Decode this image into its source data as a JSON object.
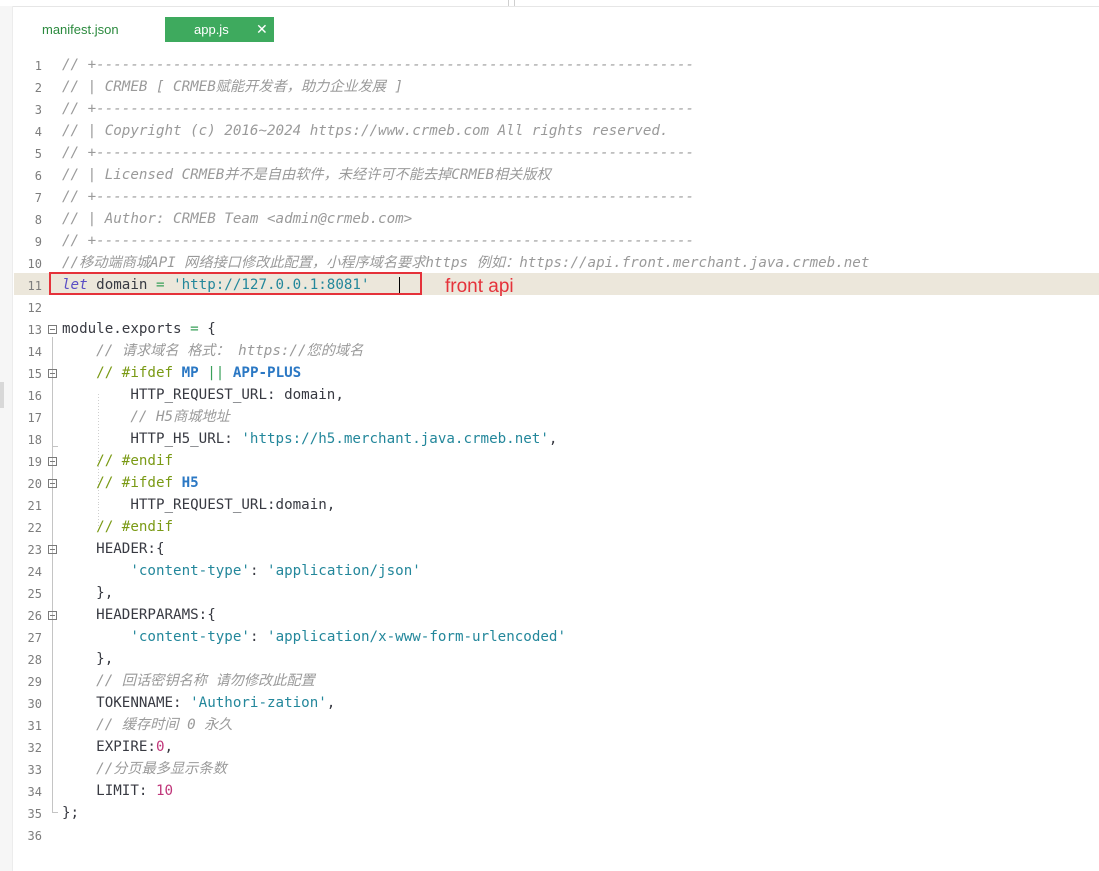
{
  "tabs": [
    {
      "label": "manifest.json",
      "active": false
    },
    {
      "label": "app.js",
      "active": true,
      "close_glyph": "✕"
    }
  ],
  "annotation": "front api",
  "colors": {
    "accent_tab": "#3eaa5e",
    "highlight_line": "#ece7db",
    "annotation_red": "#e5323a"
  },
  "editor": {
    "line_numbers": [
      "1",
      "2",
      "3",
      "4",
      "5",
      "6",
      "7",
      "8",
      "9",
      "10",
      "11",
      "12",
      "13",
      "14",
      "15",
      "16",
      "17",
      "18",
      "19",
      "20",
      "21",
      "22",
      "23",
      "24",
      "25",
      "26",
      "27",
      "28",
      "29",
      "30",
      "31",
      "32",
      "33",
      "34",
      "35",
      "36"
    ],
    "lines": [
      "// +----------------------------------------------------------------------",
      "// | CRMEB [ CRMEB赋能开发者，助力企业发展 ]",
      "// +----------------------------------------------------------------------",
      "// | Copyright (c) 2016~2024 https://www.crmeb.com All rights reserved.",
      "// +----------------------------------------------------------------------",
      "// | Licensed CRMEB并不是自由软件，未经许可不能去掉CRMEB相关版权",
      "// +----------------------------------------------------------------------",
      "// | Author: CRMEB Team <admin@crmeb.com>",
      "// +----------------------------------------------------------------------",
      "//移动端商城API 网络接口修改此配置，小程序域名要求https 例如：https://api.front.merchant.java.crmeb.net",
      "let domain = 'http://127.0.0.1:8081'",
      "",
      "module.exports = {",
      "    // 请求域名 格式： https://您的域名",
      "    // #ifdef MP || APP-PLUS",
      "        HTTP_REQUEST_URL: domain,",
      "        // H5商城地址",
      "        HTTP_H5_URL: 'https://h5.merchant.java.crmeb.net',",
      "    // #endif",
      "    // #ifdef H5",
      "        HTTP_REQUEST_URL:domain,",
      "    // #endif",
      "    HEADER:{",
      "        'content-type': 'application/json'",
      "    },",
      "    HEADERPARAMS:{",
      "        'content-type': 'application/x-www-form-urlencoded'",
      "    },",
      "    // 回话密钥名称 请勿修改此配置",
      "    TOKENNAME: 'Authori-zation',",
      "    // 缓存时间 0 永久",
      "    EXPIRE:0,",
      "    //分页最多显示条数",
      "    LIMIT: 10",
      "};",
      ""
    ]
  }
}
